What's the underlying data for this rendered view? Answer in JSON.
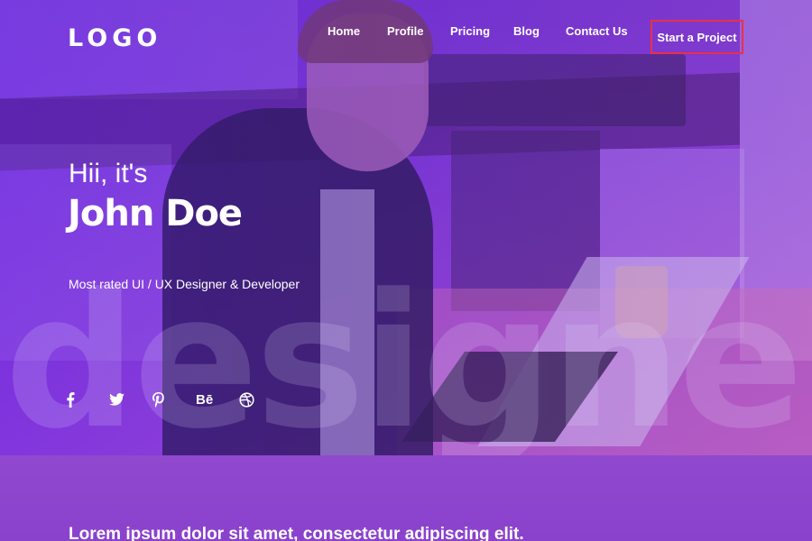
{
  "header": {
    "logo": "LOGO",
    "nav": [
      "Home",
      "Profile",
      "Pricing",
      "Blog",
      "Contact Us"
    ],
    "cta": "Start a Project"
  },
  "hero": {
    "greeting": "Hii, it's",
    "name": "John Doe",
    "tagline": "Most rated UI / UX Designer & Developer",
    "background_word": "designer"
  },
  "socials": [
    {
      "icon": "facebook-icon"
    },
    {
      "icon": "twitter-icon"
    },
    {
      "icon": "pinterest-icon"
    },
    {
      "icon": "behance-icon",
      "label": "Bē"
    },
    {
      "icon": "dribbble-icon"
    }
  ],
  "section2": {
    "heading": "Lorem ipsum dolor sit amet, consectetur adipiscing elit."
  },
  "colors": {
    "cta_border": "#e8304a",
    "hero_purple": "#6a36c8",
    "section_purple": "#8a42cd"
  }
}
